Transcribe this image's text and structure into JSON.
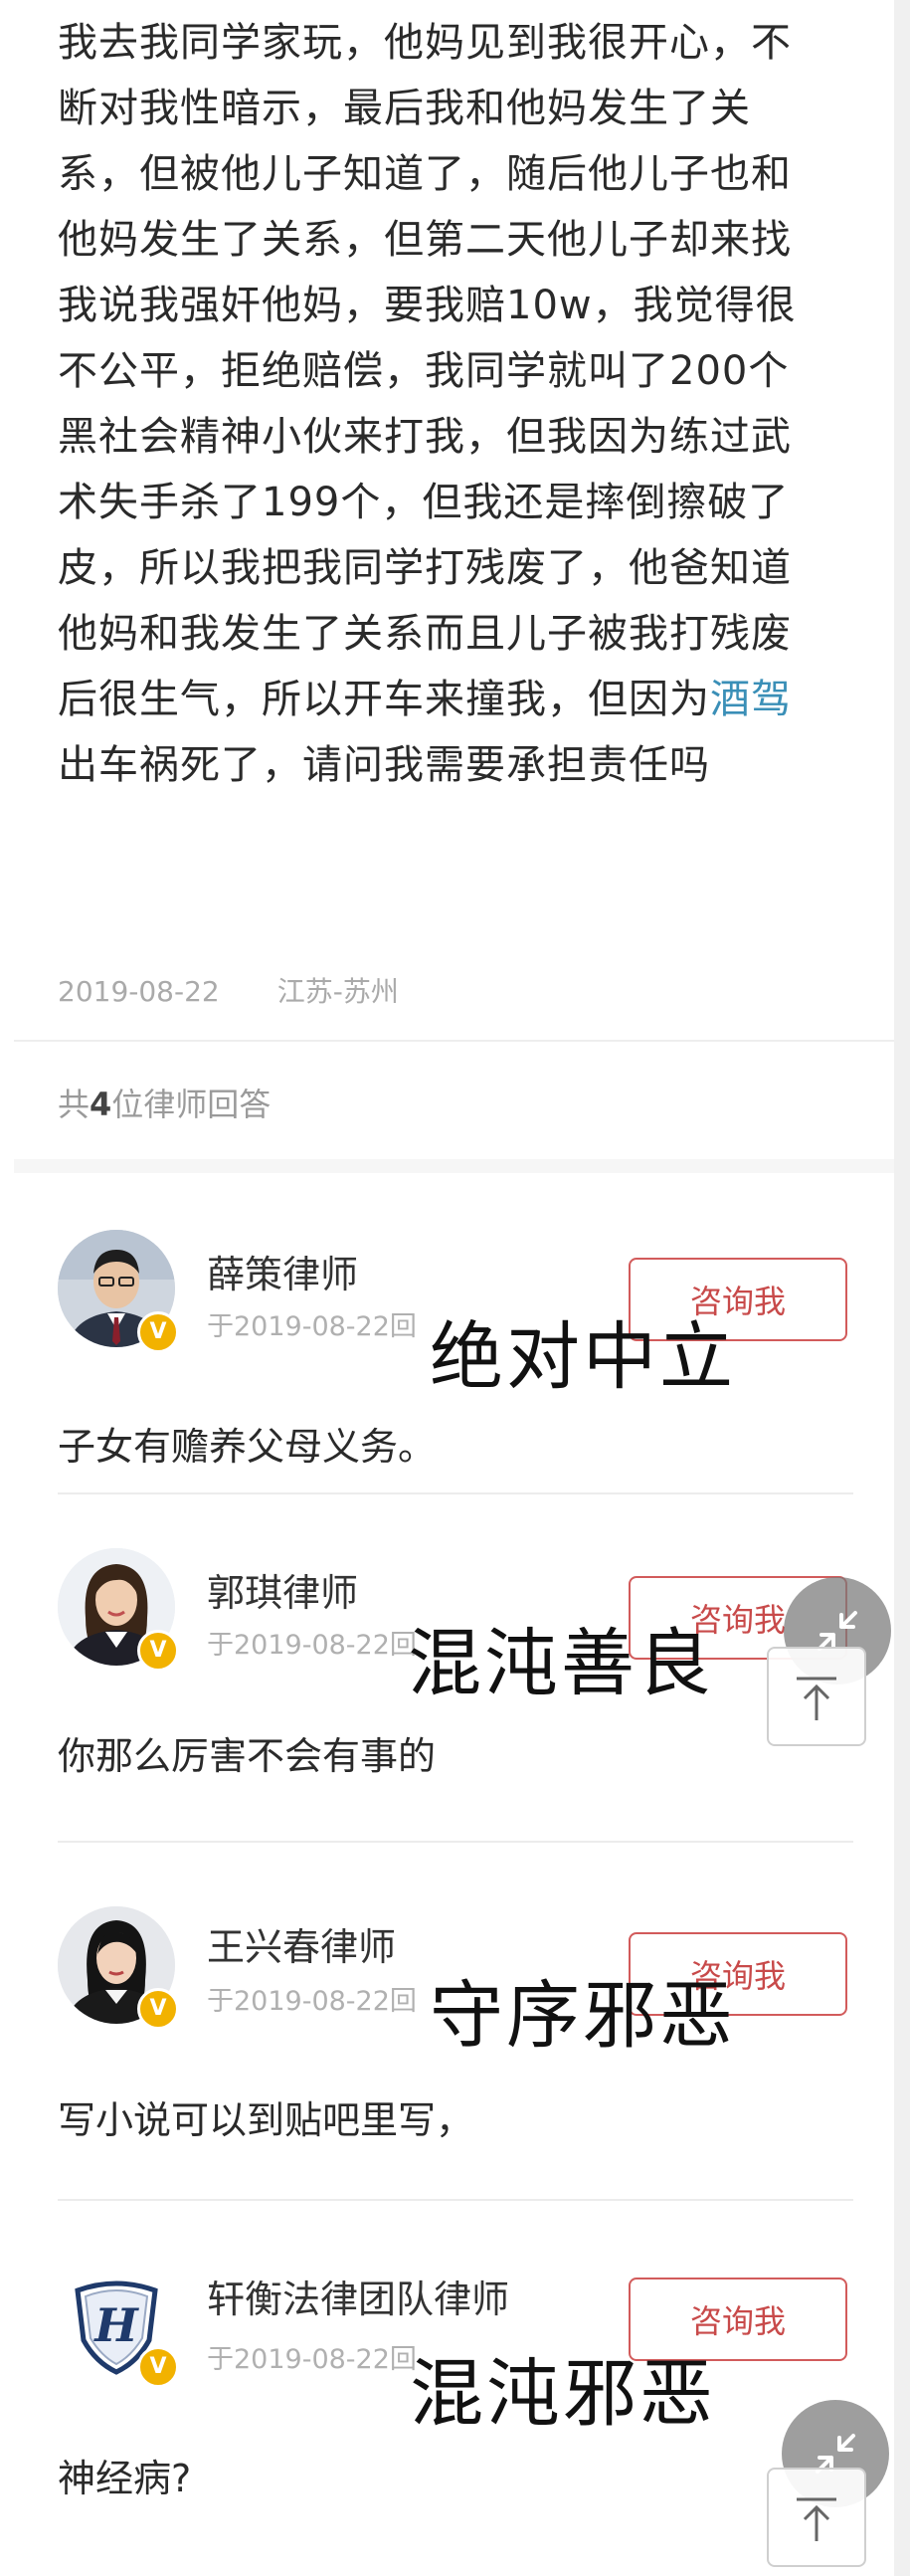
{
  "question": {
    "lines": [
      "我去我同学家玩，他妈见到我很开心，不",
      "断对我性暗示，最后我和他妈发生了关",
      "系，但被他儿子知道了，随后他儿子也和",
      "他妈发生了关系，但第二天他儿子却来找",
      "我说我强奸他妈，要我赔10w，我觉得很",
      "不公平，拒绝赔偿，我同学就叫了200个",
      "黑社会精神小伙来打我，但我因为练过武",
      "术失手杀了199个，但我还是摔倒擦破了",
      "皮，所以我把我同学打残废了，他爸知道",
      "他妈和我发生了关系而且儿子被我打残废"
    ],
    "line11_before": "后很生气，所以开车来撞我，但因为",
    "line11_link": "酒驾",
    "line12": "出车祸死了，请问我需要承担责任吗",
    "date": "2019-08-22",
    "location": "江苏-苏州"
  },
  "answers_header": {
    "prefix": "共",
    "count": "4",
    "suffix": "位律师回答"
  },
  "lawyers": [
    {
      "name": "薛策律师",
      "date": "于2019-08-22回",
      "consult_label": "咨询我",
      "answer": "子女有赡养父母义务。",
      "overlay": "绝对中立",
      "badge_icon": "verified-v-icon"
    },
    {
      "name": "郭琪律师",
      "date": "于2019-08-22回",
      "consult_label": "咨询我",
      "answer": "你那么厉害不会有事的",
      "overlay": "混沌善良",
      "badge_icon": "verified-v-icon"
    },
    {
      "name": "王兴春律师",
      "date": "于2019-08-22回",
      "consult_label": "咨询我",
      "answer": "写小说可以到贴吧里写，",
      "overlay": "守序邪恶",
      "badge_icon": "verified-v-icon"
    },
    {
      "name": "轩衡法律团队律师",
      "date": "于2019-08-22回",
      "consult_label": "咨询我",
      "answer": "神经病?",
      "overlay": "混沌邪恶",
      "badge_icon": "verified-v-icon"
    }
  ],
  "badge_text": "V",
  "logo_text": "H",
  "colors": {
    "link": "#3a8fb7",
    "consult_border": "#d25b5b",
    "badge": "#f2b200"
  }
}
